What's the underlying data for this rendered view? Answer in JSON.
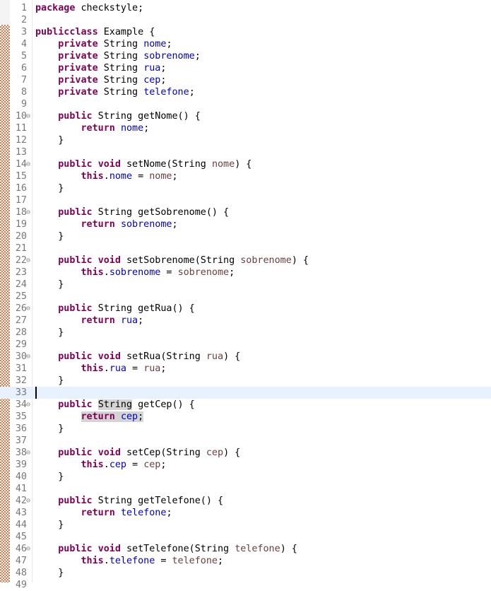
{
  "editor": {
    "language": "java",
    "current_line": 33,
    "lines": [
      {
        "n": 1,
        "fold": false,
        "tokens": [
          [
            "kw",
            "package"
          ],
          [
            "",
            "checkstyle;"
          ]
        ]
      },
      {
        "n": 2,
        "fold": false,
        "tokens": []
      },
      {
        "n": 3,
        "fold": false,
        "tokens": [
          [
            "kw",
            "public"
          ],
          [
            "",
            ""
          ],
          [
            "kw",
            "class"
          ],
          [
            "",
            "Example {"
          ]
        ]
      },
      {
        "n": 4,
        "fold": false,
        "indent": 1,
        "tokens": [
          [
            "kw",
            "private"
          ],
          [
            "",
            " String "
          ],
          [
            "fld",
            "nome"
          ],
          [
            "",
            ";"
          ]
        ]
      },
      {
        "n": 5,
        "fold": false,
        "indent": 1,
        "tokens": [
          [
            "kw",
            "private"
          ],
          [
            "",
            " String "
          ],
          [
            "fld",
            "sobrenome"
          ],
          [
            "",
            ";"
          ]
        ]
      },
      {
        "n": 6,
        "fold": false,
        "indent": 1,
        "tokens": [
          [
            "kw",
            "private"
          ],
          [
            "",
            " String "
          ],
          [
            "fld",
            "rua"
          ],
          [
            "",
            ";"
          ]
        ]
      },
      {
        "n": 7,
        "fold": false,
        "indent": 1,
        "tokens": [
          [
            "kw",
            "private"
          ],
          [
            "",
            " String "
          ],
          [
            "fld",
            "cep"
          ],
          [
            "",
            ";"
          ]
        ]
      },
      {
        "n": 8,
        "fold": false,
        "indent": 1,
        "tokens": [
          [
            "kw",
            "private"
          ],
          [
            "",
            " String "
          ],
          [
            "fld",
            "telefone"
          ],
          [
            "",
            ";"
          ]
        ]
      },
      {
        "n": 9,
        "fold": false,
        "tokens": []
      },
      {
        "n": 10,
        "fold": true,
        "indent": 1,
        "tokens": [
          [
            "kw",
            "public"
          ],
          [
            "",
            " String getNome() {"
          ]
        ]
      },
      {
        "n": 11,
        "fold": false,
        "indent": 2,
        "tokens": [
          [
            "kw",
            "return"
          ],
          [
            "",
            " "
          ],
          [
            "fld",
            "nome"
          ],
          [
            "",
            ";"
          ]
        ]
      },
      {
        "n": 12,
        "fold": false,
        "indent": 1,
        "tokens": [
          [
            "",
            "}"
          ]
        ]
      },
      {
        "n": 13,
        "fold": false,
        "tokens": []
      },
      {
        "n": 14,
        "fold": true,
        "indent": 1,
        "tokens": [
          [
            "kw",
            "public"
          ],
          [
            "",
            " "
          ],
          [
            "kw",
            "void"
          ],
          [
            "",
            " setNome(String "
          ],
          [
            "prm",
            "nome"
          ],
          [
            "",
            ") {"
          ]
        ]
      },
      {
        "n": 15,
        "fold": false,
        "indent": 2,
        "tokens": [
          [
            "kw",
            "this"
          ],
          [
            "",
            "."
          ],
          [
            "fld",
            "nome"
          ],
          [
            "",
            " = "
          ],
          [
            "prm",
            "nome"
          ],
          [
            "",
            ";"
          ]
        ]
      },
      {
        "n": 16,
        "fold": false,
        "indent": 1,
        "tokens": [
          [
            "",
            "}"
          ]
        ]
      },
      {
        "n": 17,
        "fold": false,
        "tokens": []
      },
      {
        "n": 18,
        "fold": true,
        "indent": 1,
        "tokens": [
          [
            "kw",
            "public"
          ],
          [
            "",
            " String getSobrenome() {"
          ]
        ]
      },
      {
        "n": 19,
        "fold": false,
        "indent": 2,
        "tokens": [
          [
            "kw",
            "return"
          ],
          [
            "",
            " "
          ],
          [
            "fld",
            "sobrenome"
          ],
          [
            "",
            ";"
          ]
        ]
      },
      {
        "n": 20,
        "fold": false,
        "indent": 1,
        "tokens": [
          [
            "",
            "}"
          ]
        ]
      },
      {
        "n": 21,
        "fold": false,
        "tokens": []
      },
      {
        "n": 22,
        "fold": true,
        "indent": 1,
        "tokens": [
          [
            "kw",
            "public"
          ],
          [
            "",
            " "
          ],
          [
            "kw",
            "void"
          ],
          [
            "",
            " setSobrenome(String "
          ],
          [
            "prm",
            "sobrenome"
          ],
          [
            "",
            ") {"
          ]
        ]
      },
      {
        "n": 23,
        "fold": false,
        "indent": 2,
        "tokens": [
          [
            "kw",
            "this"
          ],
          [
            "",
            "."
          ],
          [
            "fld",
            "sobrenome"
          ],
          [
            "",
            " = "
          ],
          [
            "prm",
            "sobrenome"
          ],
          [
            "",
            ";"
          ]
        ]
      },
      {
        "n": 24,
        "fold": false,
        "indent": 1,
        "tokens": [
          [
            "",
            "}"
          ]
        ]
      },
      {
        "n": 25,
        "fold": false,
        "tokens": []
      },
      {
        "n": 26,
        "fold": true,
        "indent": 1,
        "tokens": [
          [
            "kw",
            "public"
          ],
          [
            "",
            " String getRua() {"
          ]
        ]
      },
      {
        "n": 27,
        "fold": false,
        "indent": 2,
        "tokens": [
          [
            "kw",
            "return"
          ],
          [
            "",
            " "
          ],
          [
            "fld",
            "rua"
          ],
          [
            "",
            ";"
          ]
        ]
      },
      {
        "n": 28,
        "fold": false,
        "indent": 1,
        "tokens": [
          [
            "",
            "}"
          ]
        ]
      },
      {
        "n": 29,
        "fold": false,
        "tokens": []
      },
      {
        "n": 30,
        "fold": true,
        "indent": 1,
        "tokens": [
          [
            "kw",
            "public"
          ],
          [
            "",
            " "
          ],
          [
            "kw",
            "void"
          ],
          [
            "",
            " setRua(String "
          ],
          [
            "prm",
            "rua"
          ],
          [
            "",
            ") {"
          ]
        ]
      },
      {
        "n": 31,
        "fold": false,
        "indent": 2,
        "tokens": [
          [
            "kw",
            "this"
          ],
          [
            "",
            "."
          ],
          [
            "fld",
            "rua"
          ],
          [
            "",
            " = "
          ],
          [
            "prm",
            "rua"
          ],
          [
            "",
            ";"
          ]
        ]
      },
      {
        "n": 32,
        "fold": false,
        "indent": 1,
        "tokens": [
          [
            "",
            "}"
          ]
        ]
      },
      {
        "n": 33,
        "fold": false,
        "tokens": []
      },
      {
        "n": 34,
        "fold": true,
        "indent": 1,
        "tokens": [
          [
            "kw",
            "public"
          ],
          [
            "",
            " "
          ],
          [
            "occ",
            "String"
          ],
          [
            "",
            " getCep() {"
          ]
        ]
      },
      {
        "n": 35,
        "fold": false,
        "indent": 2,
        "highlight": true,
        "tokens": [
          [
            "kw",
            "return"
          ],
          [
            "",
            " "
          ],
          [
            "fld",
            "cep"
          ],
          [
            "",
            ";"
          ]
        ]
      },
      {
        "n": 36,
        "fold": false,
        "indent": 1,
        "tokens": [
          [
            "",
            "}"
          ]
        ]
      },
      {
        "n": 37,
        "fold": false,
        "tokens": []
      },
      {
        "n": 38,
        "fold": true,
        "indent": 1,
        "tokens": [
          [
            "kw",
            "public"
          ],
          [
            "",
            " "
          ],
          [
            "kw",
            "void"
          ],
          [
            "",
            " setCep(String "
          ],
          [
            "prm",
            "cep"
          ],
          [
            "",
            ") {"
          ]
        ]
      },
      {
        "n": 39,
        "fold": false,
        "indent": 2,
        "tokens": [
          [
            "kw",
            "this"
          ],
          [
            "",
            "."
          ],
          [
            "fld",
            "cep"
          ],
          [
            "",
            " = "
          ],
          [
            "prm",
            "cep"
          ],
          [
            "",
            ";"
          ]
        ]
      },
      {
        "n": 40,
        "fold": false,
        "indent": 1,
        "tokens": [
          [
            "",
            "}"
          ]
        ]
      },
      {
        "n": 41,
        "fold": false,
        "tokens": []
      },
      {
        "n": 42,
        "fold": true,
        "indent": 1,
        "tokens": [
          [
            "kw",
            "public"
          ],
          [
            "",
            " String getTelefone() {"
          ]
        ]
      },
      {
        "n": 43,
        "fold": false,
        "indent": 2,
        "tokens": [
          [
            "kw",
            "return"
          ],
          [
            "",
            " "
          ],
          [
            "fld",
            "telefone"
          ],
          [
            "",
            ";"
          ]
        ]
      },
      {
        "n": 44,
        "fold": false,
        "indent": 1,
        "tokens": [
          [
            "",
            "}"
          ]
        ]
      },
      {
        "n": 45,
        "fold": false,
        "tokens": []
      },
      {
        "n": 46,
        "fold": true,
        "indent": 1,
        "tokens": [
          [
            "kw",
            "public"
          ],
          [
            "",
            " "
          ],
          [
            "kw",
            "void"
          ],
          [
            "",
            " setTelefone(String "
          ],
          [
            "prm",
            "telefone"
          ],
          [
            "",
            ") {"
          ]
        ]
      },
      {
        "n": 47,
        "fold": false,
        "indent": 2,
        "tokens": [
          [
            "kw",
            "this"
          ],
          [
            "",
            "."
          ],
          [
            "fld",
            "telefone"
          ],
          [
            "",
            " = "
          ],
          [
            "prm",
            "telefone"
          ],
          [
            "",
            ";"
          ]
        ]
      },
      {
        "n": 48,
        "fold": false,
        "indent": 1,
        "tokens": [
          [
            "",
            "}"
          ]
        ]
      },
      {
        "n": 49,
        "fold": false,
        "tokens": []
      }
    ],
    "fold_glyph": "⊖"
  }
}
